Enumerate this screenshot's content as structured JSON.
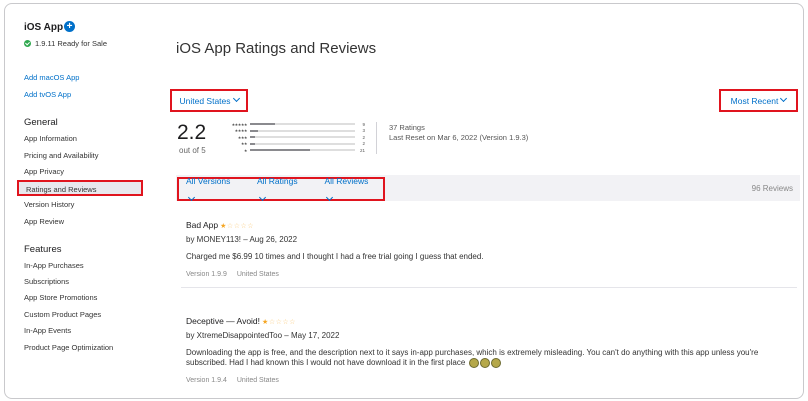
{
  "sidebar": {
    "app_title": "iOS App",
    "status": "1.9.11 Ready for Sale",
    "add_links": [
      "Add macOS App",
      "Add tvOS App"
    ],
    "general_heading": "General",
    "general_items": [
      "App Information",
      "Pricing and Availability",
      "App Privacy",
      "Ratings and Reviews",
      "Version History",
      "App Review"
    ],
    "active_item": "Ratings and Reviews",
    "features_heading": "Features",
    "feature_items": [
      "In-App Purchases",
      "Subscriptions",
      "App Store Promotions",
      "Custom Product Pages",
      "In-App Events",
      "Product Page Optimization"
    ]
  },
  "main": {
    "title": "iOS App Ratings and Reviews",
    "country_dropdown": "United States",
    "sort_dropdown": "Most Recent",
    "summary": {
      "score": "2.2",
      "out_of": "out of 5",
      "histogram": [
        {
          "stars": "★★★★★",
          "count": "9",
          "fraction": 0.24
        },
        {
          "stars": "★★★★",
          "count": "3",
          "fraction": 0.08
        },
        {
          "stars": "★★★",
          "count": "2",
          "fraction": 0.05
        },
        {
          "stars": "★★",
          "count": "2",
          "fraction": 0.05
        },
        {
          "stars": "★",
          "count": "21",
          "fraction": 0.57
        }
      ],
      "ratings_count": "37 Ratings",
      "last_reset": "Last Reset on Mar 6, 2022 (Version 1.9.3)"
    },
    "filters": {
      "versions": "All Versions",
      "ratings": "All Ratings",
      "reviews": "All Reviews",
      "total": "96 Reviews"
    },
    "reviews": [
      {
        "title": "Bad App",
        "stars": 1,
        "byline": "by MONEY113! – Aug 26, 2022",
        "body": "Charged me $6.99 10 times and I thought I had a free trial going I guess that ended.",
        "version": "Version 1.9.9",
        "country": "United States"
      },
      {
        "title": "Deceptive — Avoid!",
        "stars": 1,
        "byline": "by XtremeDisappointedToo – May 17, 2022",
        "body": "Downloading the app is free, and the description next to it says in-app purchases, which is extremely misleading. You can't do anything with this app unless you're subscribed. Had I had known this I would not have download it in the first place",
        "version": "Version 1.9.4",
        "country": "United States"
      }
    ]
  },
  "colors": {
    "accent": "#0070c9",
    "highlight_box": "#e0141e",
    "star": "#f5a623",
    "ready_green": "#2fa84f"
  }
}
